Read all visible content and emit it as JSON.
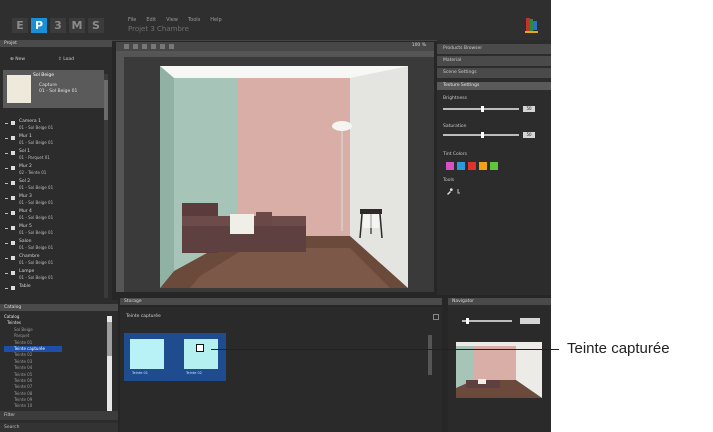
{
  "app": {
    "logo_letters": [
      "E",
      "P",
      "3",
      "M",
      "S"
    ],
    "menu": [
      "File",
      "Edit",
      "View",
      "Tools",
      "Help"
    ],
    "doc_title": "Projet 3 Chambre",
    "icon": "app-flag-icon"
  },
  "left_panel": {
    "title": "Projet",
    "btn_new": "New",
    "btn_load": "Load",
    "selected": {
      "name": "Sol Beige",
      "sub1": "Capture",
      "sub2": "01 - Sol Beige 01"
    },
    "items": [
      {
        "name": "Camera 1",
        "sub": "01 - Sol Beige 01"
      },
      {
        "name": "Mur 1",
        "sub": "01 - Sol Beige 01"
      },
      {
        "name": "Sol 1",
        "sub": "01 - Parquet 01"
      },
      {
        "name": "Mur 2",
        "sub": "02 - Teinte 01"
      },
      {
        "name": "Sol 2",
        "sub": "01 - Sol Beige 01"
      },
      {
        "name": "Mur 3",
        "sub": "01 - Sol Beige 01"
      },
      {
        "name": "Mur 4",
        "sub": "01 - Sol Beige 01"
      },
      {
        "name": "Mur 5",
        "sub": "01 - Sol Beige 01"
      },
      {
        "name": "Salon",
        "sub": "01 - Sol Beige 01"
      },
      {
        "name": "Chambre",
        "sub": "01 - Sol Beige 01"
      },
      {
        "name": "Lampe",
        "sub": "01 - Sol Beige 01"
      },
      {
        "name": "Table",
        "sub": ""
      }
    ]
  },
  "viewport": {
    "zoom": "100 %"
  },
  "right_panel": {
    "tabs": [
      "Products Browser",
      "Material",
      "Scene Settings"
    ],
    "section": "Texture Settings",
    "slider1_label": "Brightness",
    "slider1_value": 50,
    "slider2_label": "Saturation",
    "slider2_value": 50,
    "colors_label": "Tint Colors",
    "swatch_colors": [
      "#d94fc4",
      "#2a9bd8",
      "#e0312a",
      "#f2a114",
      "#5fc53a"
    ],
    "tools_label": "Tools",
    "tool_icons": [
      "eyedropper-icon",
      "brush-icon"
    ]
  },
  "bottom_left": {
    "title": "Catalog",
    "tree": [
      {
        "label": "Catalog",
        "level": 1
      },
      {
        "label": "Teintes",
        "level": 2
      },
      {
        "label": "Sol Beige",
        "level": 3
      },
      {
        "label": "Parquet",
        "level": 3
      },
      {
        "label": "Teinte 01",
        "level": 3
      },
      {
        "label": "Teinte capturée",
        "level": 3,
        "selected": true
      },
      {
        "label": "Teinte 02",
        "level": 3
      },
      {
        "label": "Teinte 03",
        "level": 3
      },
      {
        "label": "Teinte 04",
        "level": 3
      },
      {
        "label": "Teinte 05",
        "level": 3
      },
      {
        "label": "Teinte 06",
        "level": 3
      },
      {
        "label": "Teinte 07",
        "level": 3
      },
      {
        "label": "Teinte 08",
        "level": 3
      },
      {
        "label": "Teinte 09",
        "level": 3
      },
      {
        "label": "Teinte 10",
        "level": 3
      },
      {
        "label": "Teinte 11",
        "level": 3
      }
    ],
    "footer1": "Filter",
    "footer2": "Search"
  },
  "tray": {
    "header": "Storage",
    "title": "Teinte capturée",
    "tiles": [
      {
        "color": "#b8f2f6",
        "label": "Teinte 01"
      },
      {
        "color": "#b3f0ef",
        "label": "Teinte 02"
      }
    ]
  },
  "navigator": {
    "title": "Navigator",
    "value": "100 %"
  },
  "annotation": {
    "label": "Teinte capturée"
  }
}
